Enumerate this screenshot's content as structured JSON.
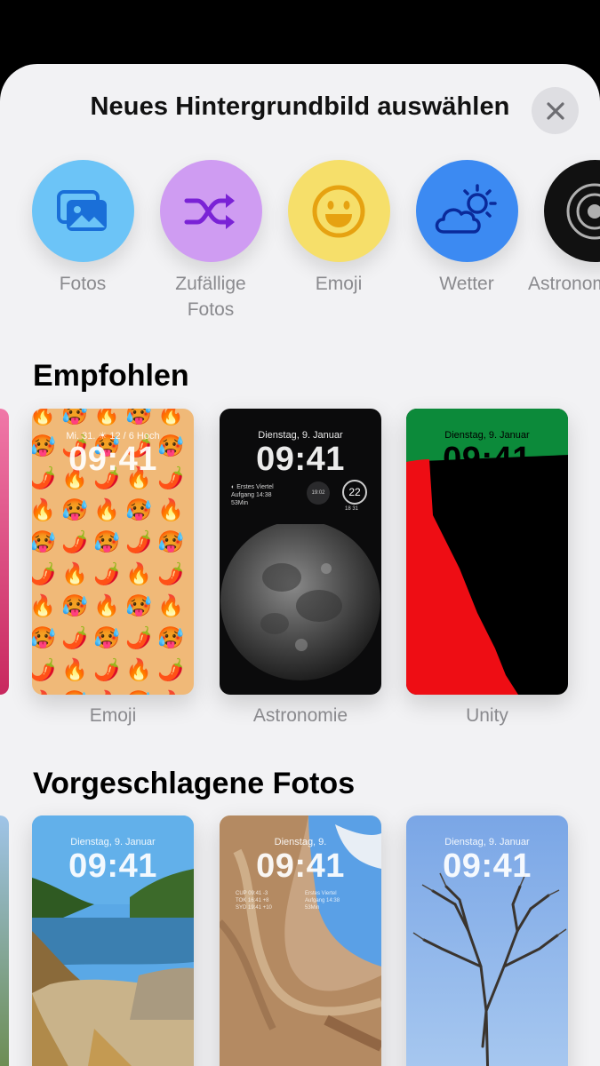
{
  "header": {
    "title": "Neues Hintergrundbild auswählen",
    "close_icon": "close-icon"
  },
  "categories": [
    {
      "id": "fotos",
      "label": "Fotos",
      "color": "#6cc4f7",
      "icon": "photos-icon"
    },
    {
      "id": "zufaellige-fotos",
      "label": "Zufällige\nFotos",
      "color": "#cf9cf2",
      "icon": "shuffle-icon"
    },
    {
      "id": "emoji",
      "label": "Emoji",
      "color": "#f6df6a",
      "icon": "smiley-icon"
    },
    {
      "id": "wetter",
      "label": "Wetter",
      "color": "#3c8af2",
      "icon": "weather-icon"
    },
    {
      "id": "astronomie",
      "label": "Astronomie",
      "color": "#111111",
      "icon": "astronomy-icon"
    }
  ],
  "sections": {
    "recommended": {
      "title": "Empfohlen"
    },
    "suggested_photos": {
      "title": "Vorgeschlagene Fotos"
    }
  },
  "recommended_cards": [
    {
      "label": "Emoji",
      "date": "Mi. 31. ☀ 12 / 6 Hoch",
      "time": "09:41",
      "emojis": [
        "🔥",
        "🥵",
        "🌶️"
      ]
    },
    {
      "label": "Astronomie",
      "date": "Dienstag, 9. Januar",
      "time": "09:41",
      "widgets": {
        "moon_phase": "Erstes Viertel",
        "moon_rise": "Aufgang 14:38",
        "moon_extra": "53Min",
        "temp_dial": "22",
        "dial_sub": "18 31",
        "center_dial": "19:02"
      }
    },
    {
      "label": "Unity",
      "date": "Dienstag, 9. Januar",
      "time": "09:41"
    }
  ],
  "suggested_cards": [
    {
      "date": "Dienstag, 9. Januar",
      "time": "09:41"
    },
    {
      "date": "Dienstag, 9.",
      "time": "09:41",
      "widgets": {
        "moon": "Erstes Viertel",
        "rise": "Aufgang 14:38",
        "extra": "53Min",
        "rows": [
          "CUP 09:41 -3",
          "TOK 16:41 +8",
          "SYD 19:41 +10"
        ]
      }
    },
    {
      "date": "Dienstag, 9. Januar",
      "time": "09:41"
    }
  ],
  "colors": {
    "unity_green": "#0c8a3a",
    "unity_red": "#ee0d14",
    "sheet_bg": "#f2f2f4",
    "label_gray": "#8a8a8e"
  }
}
